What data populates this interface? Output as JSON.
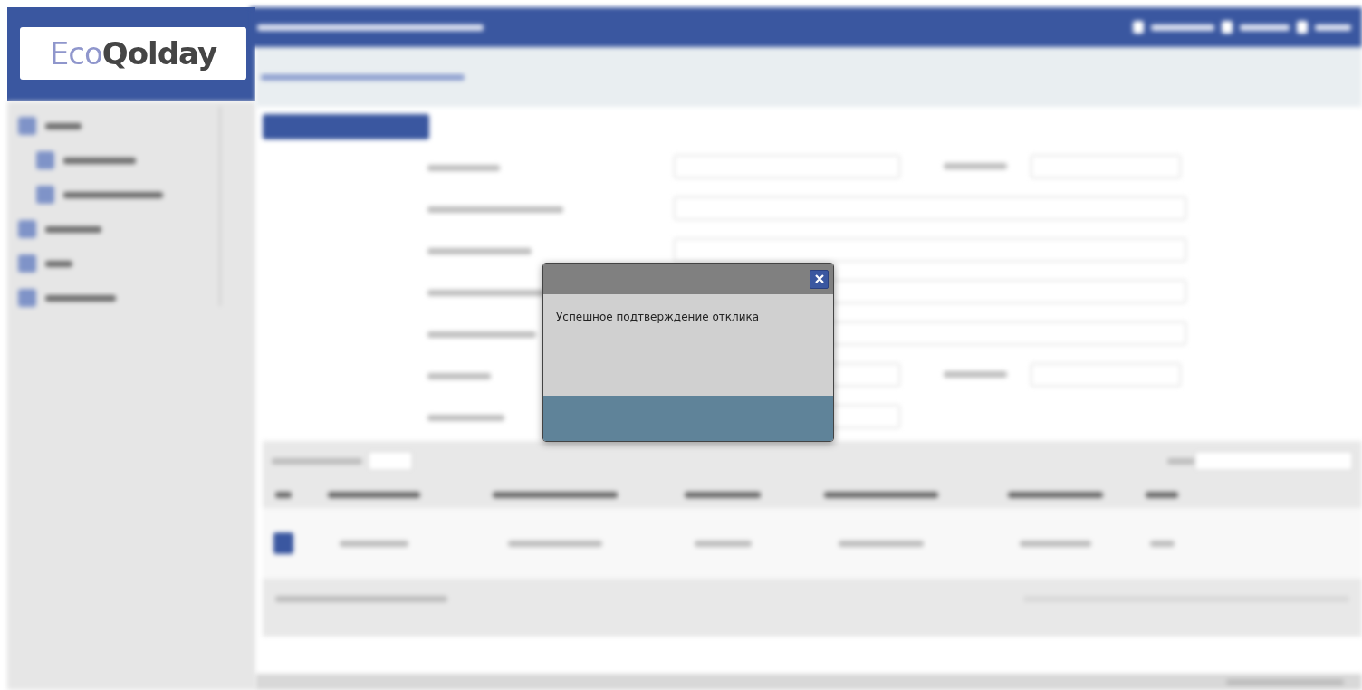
{
  "logo": "Eco**Qolday**",
  "dialog": {
    "message": "Успешное подтверждение отклика"
  }
}
